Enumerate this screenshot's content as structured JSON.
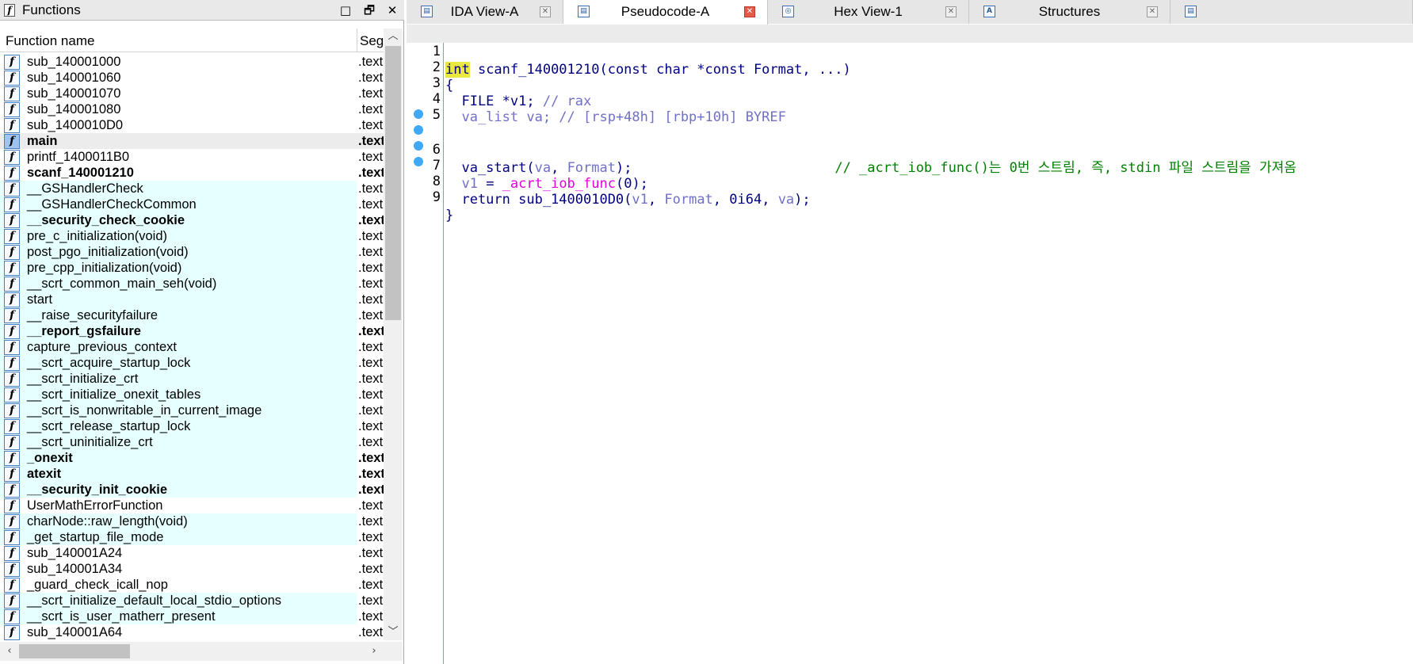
{
  "functions_pane": {
    "title": "Functions",
    "restore_btn": "□",
    "float_btn": "🗗",
    "close_btn": "✕",
    "col_name": "Function name",
    "col_segment": "Segment",
    "rows": [
      {
        "name": "sub_140001000",
        "seg": ".text",
        "style": "normal"
      },
      {
        "name": "sub_140001060",
        "seg": ".text",
        "style": "normal"
      },
      {
        "name": "sub_140001070",
        "seg": ".text",
        "style": "normal"
      },
      {
        "name": "sub_140001080",
        "seg": ".text",
        "style": "normal"
      },
      {
        "name": "sub_1400010D0",
        "seg": ".text",
        "style": "normal"
      },
      {
        "name": "main",
        "seg": ".text",
        "style": "selected-bold"
      },
      {
        "name": "printf_1400011B0",
        "seg": ".text",
        "style": "normal"
      },
      {
        "name": "scanf_140001210",
        "seg": ".text",
        "style": "bold"
      },
      {
        "name": "__GSHandlerCheck",
        "seg": ".text",
        "style": "lib"
      },
      {
        "name": "__GSHandlerCheckCommon",
        "seg": ".text",
        "style": "lib"
      },
      {
        "name": "__security_check_cookie",
        "seg": ".text",
        "style": "lib-bold"
      },
      {
        "name": "pre_c_initialization(void)",
        "seg": ".text",
        "style": "lib"
      },
      {
        "name": "post_pgo_initialization(void)",
        "seg": ".text",
        "style": "lib"
      },
      {
        "name": "pre_cpp_initialization(void)",
        "seg": ".text",
        "style": "lib"
      },
      {
        "name": "__scrt_common_main_seh(void)",
        "seg": ".text",
        "style": "lib"
      },
      {
        "name": "start",
        "seg": ".text",
        "style": "lib"
      },
      {
        "name": "__raise_securityfailure",
        "seg": ".text",
        "style": "lib"
      },
      {
        "name": "__report_gsfailure",
        "seg": ".text",
        "style": "lib-bold"
      },
      {
        "name": "capture_previous_context",
        "seg": ".text",
        "style": "lib"
      },
      {
        "name": "__scrt_acquire_startup_lock",
        "seg": ".text",
        "style": "lib"
      },
      {
        "name": "__scrt_initialize_crt",
        "seg": ".text",
        "style": "lib"
      },
      {
        "name": "__scrt_initialize_onexit_tables",
        "seg": ".text",
        "style": "lib"
      },
      {
        "name": "__scrt_is_nonwritable_in_current_image",
        "seg": ".text",
        "style": "lib"
      },
      {
        "name": "__scrt_release_startup_lock",
        "seg": ".text",
        "style": "lib"
      },
      {
        "name": "__scrt_uninitialize_crt",
        "seg": ".text",
        "style": "lib"
      },
      {
        "name": "_onexit",
        "seg": ".text",
        "style": "lib-bold"
      },
      {
        "name": "atexit",
        "seg": ".text",
        "style": "lib-bold"
      },
      {
        "name": "__security_init_cookie",
        "seg": ".text",
        "style": "lib-bold"
      },
      {
        "name": "UserMathErrorFunction",
        "seg": ".text",
        "style": "normal"
      },
      {
        "name": "charNode::raw_length(void)",
        "seg": ".text",
        "style": "lib"
      },
      {
        "name": "_get_startup_file_mode",
        "seg": ".text",
        "style": "lib"
      },
      {
        "name": "sub_140001A24",
        "seg": ".text",
        "style": "normal"
      },
      {
        "name": "sub_140001A34",
        "seg": ".text",
        "style": "normal"
      },
      {
        "name": "_guard_check_icall_nop",
        "seg": ".text",
        "style": "normal"
      },
      {
        "name": "__scrt_initialize_default_local_stdio_options",
        "seg": ".text",
        "style": "lib"
      },
      {
        "name": "__scrt_is_user_matherr_present",
        "seg": ".text",
        "style": "lib"
      },
      {
        "name": "sub_140001A64",
        "seg": ".text",
        "style": "normal"
      }
    ]
  },
  "tabs": [
    {
      "label": "IDA View-A",
      "icon": "ida-view-icon",
      "glyph": "▤",
      "active": false
    },
    {
      "label": "Pseudocode-A",
      "icon": "pseudocode-icon",
      "glyph": "▤",
      "active": true
    },
    {
      "label": "Hex View-1",
      "icon": "hex-view-icon",
      "glyph": "◎",
      "active": false
    },
    {
      "label": "Structures",
      "icon": "structures-icon",
      "glyph": "A",
      "active": false
    },
    {
      "label": "",
      "icon": "enums-icon",
      "glyph": "▤",
      "active": false
    }
  ],
  "tab_close_glyph": "✕",
  "code": {
    "lines": [
      {
        "num": "1",
        "bp": false,
        "current": true
      },
      {
        "num": "2",
        "bp": false,
        "current": false
      },
      {
        "num": "3",
        "bp": false,
        "current": false
      },
      {
        "num": "4",
        "bp": false,
        "current": false
      },
      {
        "num": "5",
        "bp": false,
        "current": false
      },
      {
        "num": "6",
        "bp": true,
        "current": false
      },
      {
        "num": "7",
        "bp": true,
        "current": false
      },
      {
        "num": "8",
        "bp": true,
        "current": false
      },
      {
        "num": "9",
        "bp": true,
        "current": false
      }
    ],
    "l1_kw": "int",
    "l1_rest": " scanf_140001210(const char *const Format, ...)",
    "l2": "{",
    "l3_a": "  FILE *v1; ",
    "l3_c": "// rax",
    "l4_a": "  va_list va; ",
    "l4_c": "// [rsp+48h] [rbp+10h] BYREF",
    "l6_a": "  va_start(",
    "l6_v": "va",
    "l6_b": ", ",
    "l6_f": "Format",
    "l6_e": ");",
    "l6_pad": "                         ",
    "l6_c": "// _acrt_iob_func()는 0번 스트림, 즉, stdin 파일 스트림을 가져옴",
    "l7_v": "  v1",
    "l7_b": " = ",
    "l7_f": "_acrt_iob_func",
    "l7_e": "(0);",
    "l8_a": "  return sub_1400010D0(",
    "l8_v1": "v1",
    "l8_b": ", ",
    "l8_f": "Format",
    "l8_c": ", 0i64, ",
    "l8_va": "va",
    "l8_e": ");",
    "l9": "}"
  },
  "scroll": {
    "up": "︿",
    "down": "﹀",
    "left": "‹",
    "right": "›"
  },
  "colors": {
    "library_bg": "#e6ffff",
    "keyword_highlight": "#e8e840",
    "comment": "#007f00",
    "import": "#e000e0",
    "breakpoint": "#3fa9f5"
  }
}
